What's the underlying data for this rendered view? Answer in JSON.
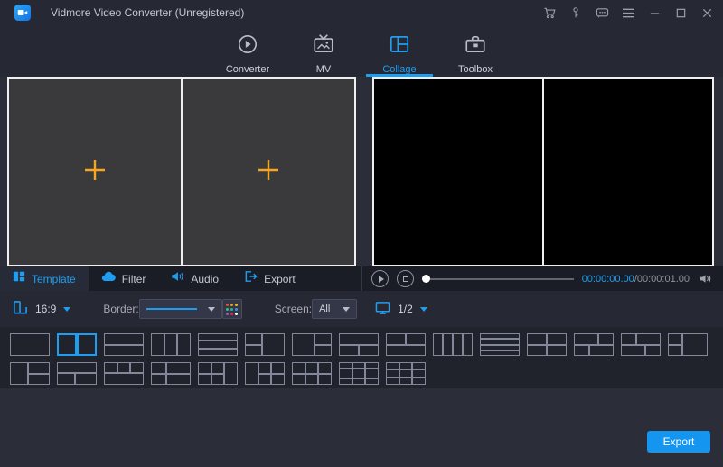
{
  "window": {
    "title": "Vidmore Video Converter (Unregistered)",
    "titlebar_icons": [
      "cart-icon",
      "key-icon",
      "feedback-icon",
      "menu-icon",
      "minimize-icon",
      "maximize-icon",
      "close-icon"
    ]
  },
  "nav": {
    "tabs": [
      {
        "label": "Converter",
        "icon": "converter-icon",
        "active": false
      },
      {
        "label": "MV",
        "icon": "mv-icon",
        "active": false
      },
      {
        "label": "Collage",
        "icon": "collage-icon",
        "active": true
      },
      {
        "label": "Toolbox",
        "icon": "toolbox-icon",
        "active": false
      }
    ]
  },
  "canvas": {
    "cells": 2,
    "placeholder_icon": "plus-icon"
  },
  "editor_tabs": [
    {
      "label": "Template",
      "icon": "template-icon",
      "active": true
    },
    {
      "label": "Filter",
      "icon": "filter-cloud-icon",
      "active": false
    },
    {
      "label": "Audio",
      "icon": "audio-speaker-icon",
      "active": false
    },
    {
      "label": "Export",
      "icon": "export-arrow-icon",
      "active": false
    }
  ],
  "player": {
    "time_current": "00:00:00.00",
    "time_separator": "/",
    "time_total": "00:00:01.00",
    "progress_percent": 0,
    "controls": [
      "play-button",
      "stop-button",
      "seek-slider",
      "volume-icon"
    ]
  },
  "settings": {
    "aspect_ratio_value": "16:9",
    "border_label": "Border:",
    "screen_label": "Screen:",
    "screen_value": "All",
    "screen_page": "1/2",
    "border_color_swatches": [
      "#e74c3c",
      "#f39c12",
      "#f1c40f",
      "#2ecc71",
      "#1abc9c",
      "#3498db",
      "#9b59b6",
      "#e91e63",
      "#ffffff"
    ]
  },
  "templates": {
    "selected": {
      "row": "row1",
      "index": 1
    },
    "row1": [
      {
        "name": "single",
        "cells": [
          [
            0,
            0,
            100,
            100
          ]
        ]
      },
      {
        "name": "two-columns",
        "cells": [
          [
            0,
            0,
            50,
            100
          ],
          [
            50,
            0,
            50,
            100
          ]
        ]
      },
      {
        "name": "two-rows",
        "cells": [
          [
            0,
            0,
            100,
            50
          ],
          [
            0,
            50,
            100,
            50
          ]
        ]
      },
      {
        "name": "three-columns",
        "cells": [
          [
            0,
            0,
            33.3,
            100
          ],
          [
            33.3,
            0,
            33.4,
            100
          ],
          [
            66.7,
            0,
            33.3,
            100
          ]
        ]
      },
      {
        "name": "three-rows",
        "cells": [
          [
            0,
            0,
            100,
            33.3
          ],
          [
            0,
            33.3,
            100,
            33.4
          ],
          [
            0,
            66.7,
            100,
            33.3
          ]
        ]
      },
      {
        "name": "left-stack-right-large",
        "cells": [
          [
            0,
            0,
            44,
            50
          ],
          [
            0,
            50,
            44,
            50
          ],
          [
            44,
            0,
            56,
            100
          ]
        ]
      },
      {
        "name": "left-large-right-stack",
        "cells": [
          [
            0,
            0,
            56,
            100
          ],
          [
            56,
            0,
            44,
            50
          ],
          [
            56,
            50,
            44,
            50
          ]
        ]
      },
      {
        "name": "top-large-bottom-split",
        "cells": [
          [
            0,
            0,
            100,
            50
          ],
          [
            0,
            50,
            50,
            50
          ],
          [
            50,
            50,
            50,
            50
          ]
        ]
      },
      {
        "name": "top-split-bottom-large",
        "cells": [
          [
            0,
            0,
            50,
            50
          ],
          [
            50,
            0,
            50,
            50
          ],
          [
            0,
            50,
            100,
            50
          ]
        ]
      },
      {
        "name": "four-columns",
        "cells": [
          [
            0,
            0,
            25,
            100
          ],
          [
            25,
            0,
            25,
            100
          ],
          [
            50,
            0,
            25,
            100
          ],
          [
            75,
            0,
            25,
            100
          ]
        ]
      },
      {
        "name": "four-rows",
        "cells": [
          [
            0,
            0,
            100,
            25
          ],
          [
            0,
            25,
            100,
            25
          ],
          [
            0,
            50,
            100,
            25
          ],
          [
            0,
            75,
            100,
            25
          ]
        ]
      },
      {
        "name": "grid-2x2",
        "cells": [
          [
            0,
            0,
            50,
            50
          ],
          [
            50,
            0,
            50,
            50
          ],
          [
            0,
            50,
            50,
            50
          ],
          [
            50,
            50,
            50,
            50
          ]
        ]
      },
      {
        "name": "mosaic-wide-top-left",
        "cells": [
          [
            0,
            0,
            62,
            50
          ],
          [
            62,
            0,
            38,
            50
          ],
          [
            0,
            50,
            38,
            50
          ],
          [
            38,
            50,
            62,
            50
          ]
        ]
      },
      {
        "name": "mosaic-wide-top-right",
        "cells": [
          [
            0,
            0,
            38,
            50
          ],
          [
            38,
            0,
            62,
            50
          ],
          [
            0,
            50,
            62,
            50
          ],
          [
            62,
            50,
            38,
            50
          ]
        ]
      },
      {
        "name": "narrow-left-stack",
        "cells": [
          [
            0,
            0,
            36,
            50
          ],
          [
            0,
            50,
            36,
            50
          ],
          [
            36,
            0,
            64,
            100
          ]
        ]
      }
    ],
    "row2": [
      {
        "name": "left-large-right-rows",
        "cells": [
          [
            0,
            0,
            46,
            100
          ],
          [
            46,
            0,
            54,
            50
          ],
          [
            46,
            50,
            54,
            50
          ]
        ]
      },
      {
        "name": "top-large-bottom-cols",
        "cells": [
          [
            0,
            0,
            100,
            46
          ],
          [
            0,
            46,
            46,
            54
          ],
          [
            46,
            46,
            54,
            54
          ]
        ]
      },
      {
        "name": "top-three-bottom-large",
        "cells": [
          [
            0,
            0,
            33.3,
            46
          ],
          [
            33.3,
            0,
            33.4,
            46
          ],
          [
            66.7,
            0,
            33.3,
            46
          ],
          [
            0,
            46,
            100,
            54
          ]
        ]
      },
      {
        "name": "grid-2x2-narrow-left",
        "cells": [
          [
            0,
            0,
            38,
            50
          ],
          [
            38,
            0,
            62,
            50
          ],
          [
            0,
            50,
            38,
            50
          ],
          [
            38,
            50,
            62,
            50
          ]
        ]
      },
      {
        "name": "quad-left-large-right",
        "cells": [
          [
            0,
            0,
            33,
            50
          ],
          [
            33,
            0,
            33,
            50
          ],
          [
            0,
            50,
            33,
            50
          ],
          [
            33,
            50,
            33,
            50
          ],
          [
            66,
            0,
            34,
            100
          ]
        ]
      },
      {
        "name": "large-left-quad-right",
        "cells": [
          [
            0,
            0,
            34,
            100
          ],
          [
            34,
            0,
            33,
            50
          ],
          [
            67,
            0,
            33,
            50
          ],
          [
            34,
            50,
            33,
            50
          ],
          [
            67,
            50,
            33,
            50
          ]
        ]
      },
      {
        "name": "grid-3x2",
        "cells": [
          [
            0,
            0,
            33.3,
            50
          ],
          [
            33.3,
            0,
            33.4,
            50
          ],
          [
            66.7,
            0,
            33.3,
            50
          ],
          [
            0,
            50,
            33.3,
            50
          ],
          [
            33.3,
            50,
            33.4,
            50
          ],
          [
            66.7,
            50,
            33.3,
            50
          ]
        ]
      },
      {
        "name": "grid-3x3-wide-middle",
        "cells": [
          [
            0,
            0,
            33.3,
            28
          ],
          [
            33.3,
            0,
            33.4,
            28
          ],
          [
            66.7,
            0,
            33.3,
            28
          ],
          [
            0,
            28,
            33.3,
            44
          ],
          [
            33.3,
            28,
            33.4,
            44
          ],
          [
            66.7,
            28,
            33.3,
            44
          ],
          [
            0,
            72,
            33.3,
            28
          ],
          [
            33.3,
            72,
            33.4,
            28
          ],
          [
            66.7,
            72,
            33.3,
            28
          ]
        ]
      },
      {
        "name": "grid-3x3",
        "cells": [
          [
            0,
            0,
            33.3,
            33.3
          ],
          [
            33.3,
            0,
            33.4,
            33.3
          ],
          [
            66.7,
            0,
            33.3,
            33.3
          ],
          [
            0,
            33.3,
            33.3,
            33.4
          ],
          [
            33.3,
            33.3,
            33.4,
            33.4
          ],
          [
            66.7,
            33.3,
            33.3,
            33.4
          ],
          [
            0,
            66.7,
            33.3,
            33.3
          ],
          [
            33.3,
            66.7,
            33.4,
            33.3
          ],
          [
            66.7,
            66.7,
            33.3,
            33.3
          ]
        ]
      }
    ]
  },
  "export_button_label": "Export",
  "colors": {
    "accent": "#1e9ef0",
    "plus_icon": "#f5a623",
    "export_button": "#1496f0",
    "titlebar_bg": "#262834",
    "content_bg": "#2b2d39",
    "strip_bg": "#1b1d26",
    "grid_bg": "#20222c",
    "thumb_outline": "#83879a",
    "preview_cell": "#3a3a3c",
    "preview_border": "#efefef"
  }
}
